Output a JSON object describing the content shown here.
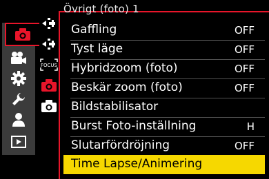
{
  "panel": {
    "title": "Övrigt (foto) 1"
  },
  "main_tabs": [
    {
      "icon": "camera-icon",
      "active": true
    },
    {
      "icon": "video-camera-icon",
      "active": false
    },
    {
      "icon": "gear-icon",
      "active": false
    },
    {
      "icon": "wrench-icon",
      "active": false
    },
    {
      "icon": "person-icon",
      "active": false
    },
    {
      "icon": "playback-icon",
      "active": false
    }
  ],
  "sub_tabs": [
    {
      "icon": "af-dial-icon"
    },
    {
      "icon": "af-dial-icon"
    },
    {
      "icon": "focus-icon",
      "text": "FOCUS"
    },
    {
      "icon": "camera-icon",
      "active": true
    },
    {
      "icon": "camera-icon"
    }
  ],
  "menu": {
    "items": [
      {
        "label": "Gaffling",
        "value": "OFF"
      },
      {
        "label": "Tyst läge",
        "value": "OFF"
      },
      {
        "label": "Hybridzoom (foto)",
        "value": "OFF"
      },
      {
        "label": "Beskär zoom (foto)",
        "value": "OFF"
      },
      {
        "label": "Bildstabilisator",
        "value": ""
      },
      {
        "label": "Burst Foto-inställning",
        "value": "H"
      },
      {
        "label": "Slutarfördröjning",
        "value": "OFF"
      },
      {
        "label": "Time Lapse/Animering",
        "value": "",
        "selected": true
      }
    ]
  },
  "colors": {
    "accent_red": "#e8152a",
    "selection_yellow": "#f6d800",
    "tab_bg": "#3b3b3b"
  }
}
